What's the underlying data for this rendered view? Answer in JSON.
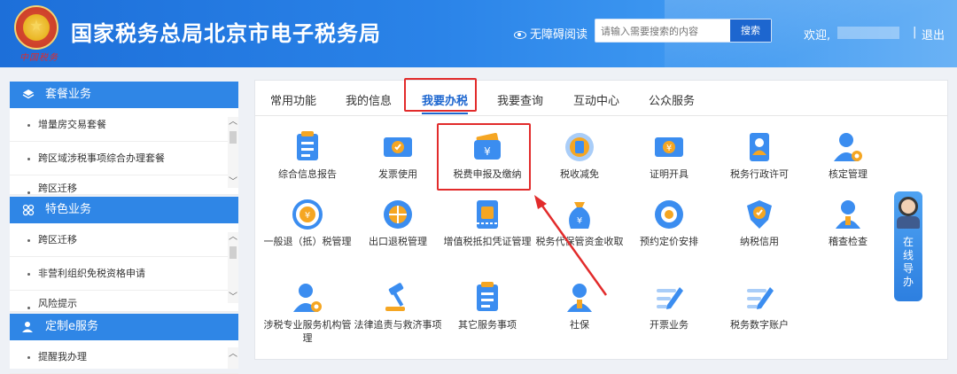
{
  "header": {
    "title": "国家税务总局北京市电子税务局",
    "emblem_text": "中国税务",
    "accessibility": "无障碍阅读",
    "search_placeholder": "请输入需要搜索的内容",
    "search_button": "搜索",
    "welcome": "欢迎,",
    "separator": "|",
    "logout": "退出"
  },
  "sidebar": {
    "sections": [
      {
        "title": "套餐业务",
        "items": [
          "增量房交易套餐",
          "跨区域涉税事项综合办理套餐",
          "跨区迁移"
        ]
      },
      {
        "title": "特色业务",
        "items": [
          "跨区迁移",
          "非营利组织免税资格申请",
          "风险提示"
        ]
      },
      {
        "title": "定制e服务",
        "items": [
          "提醒我办理"
        ]
      }
    ]
  },
  "tabs": [
    "常用功能",
    "我的信息",
    "我要办税",
    "我要查询",
    "互动中心",
    "公众服务"
  ],
  "active_tab": "我要办税",
  "tiles": [
    "综合信息报告",
    "发票使用",
    "税费申报及缴纳",
    "税收减免",
    "证明开具",
    "税务行政许可",
    "核定管理",
    "一般退（抵）税管理",
    "出口退税管理",
    "增值税抵扣凭证管理",
    "税务代保管资金收取",
    "预约定价安排",
    "纳税信用",
    "稽查检查",
    "涉税专业服务机构管理",
    "法律追责与救济事项",
    "其它服务事项",
    "社保",
    "开票业务",
    "税务数字账户"
  ],
  "online_guide": "在线导办",
  "colors": {
    "header_blue": "#2a83e8",
    "accent": "#1d66cf",
    "highlight_red": "#e22b2b",
    "icon_blue": "#3b8df0",
    "icon_orange": "#f5a623"
  }
}
